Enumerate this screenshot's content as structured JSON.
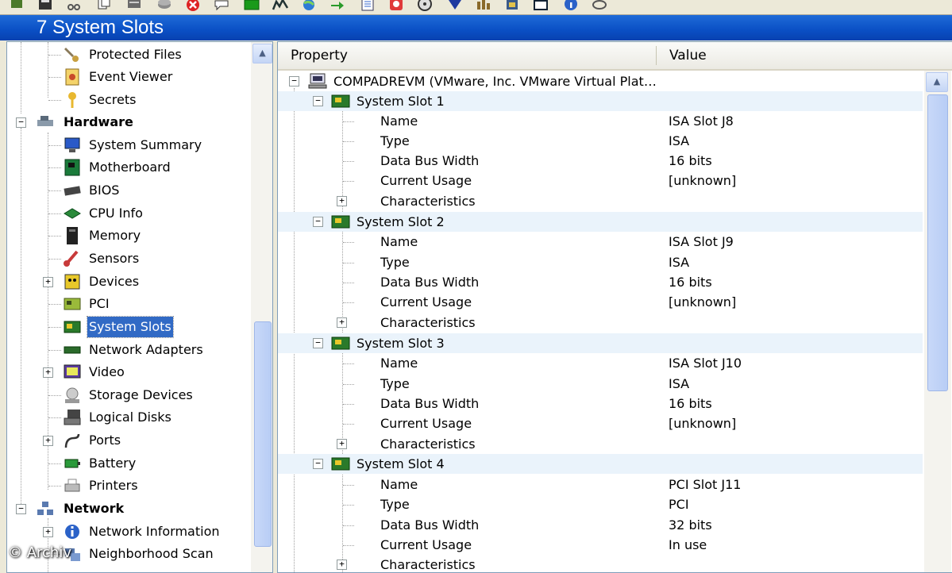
{
  "window": {
    "title": "7 System Slots"
  },
  "toolbar": {
    "icons": [
      "connect-icon",
      "save-icon",
      "cut-icon",
      "copy-icon",
      "stack-icon",
      "stop-icon",
      "chat-icon",
      "monitor-icon",
      "chart-icon",
      "globe-icon",
      "arrow-icon",
      "report-icon",
      "clock-icon",
      "cd-icon",
      "shield-icon",
      "bench-icon",
      "cpu-icon",
      "window-icon",
      "info-icon",
      "search-icon"
    ]
  },
  "tree": {
    "protected_files": "Protected Files",
    "event_viewer": "Event Viewer",
    "secrets": "Secrets",
    "hardware": "Hardware",
    "system_summary": "System Summary",
    "motherboard": "Motherboard",
    "bios": "BIOS",
    "cpu_info": "CPU Info",
    "memory": "Memory",
    "sensors": "Sensors",
    "devices": "Devices",
    "pci": "PCI",
    "system_slots": "System Slots",
    "network_adapters": "Network Adapters",
    "video": "Video",
    "storage_devices": "Storage Devices",
    "logical_disks": "Logical Disks",
    "ports": "Ports",
    "battery": "Battery",
    "printers": "Printers",
    "network": "Network",
    "network_information": "Network Information",
    "neighborhood_scan": "Neighborhood Scan"
  },
  "props": {
    "col_property": "Property",
    "col_value": "Value",
    "root": "COMPADREVM (VMware, Inc. VMware Virtual Plat…",
    "labels": {
      "name": "Name",
      "type": "Type",
      "width": "Data Bus Width",
      "usage": "Current Usage",
      "characteristics": "Characteristics"
    },
    "slots": [
      {
        "title": "System Slot 1",
        "name": "ISA Slot J8",
        "type": "ISA",
        "width": "16 bits",
        "usage": "[unknown]"
      },
      {
        "title": "System Slot 2",
        "name": "ISA Slot J9",
        "type": "ISA",
        "width": "16 bits",
        "usage": "[unknown]"
      },
      {
        "title": "System Slot 3",
        "name": "ISA Slot J10",
        "type": "ISA",
        "width": "16 bits",
        "usage": "[unknown]"
      },
      {
        "title": "System Slot 4",
        "name": "PCI Slot J11",
        "type": "PCI",
        "width": "32 bits",
        "usage": "In use"
      }
    ]
  },
  "watermark": "© Archiv"
}
